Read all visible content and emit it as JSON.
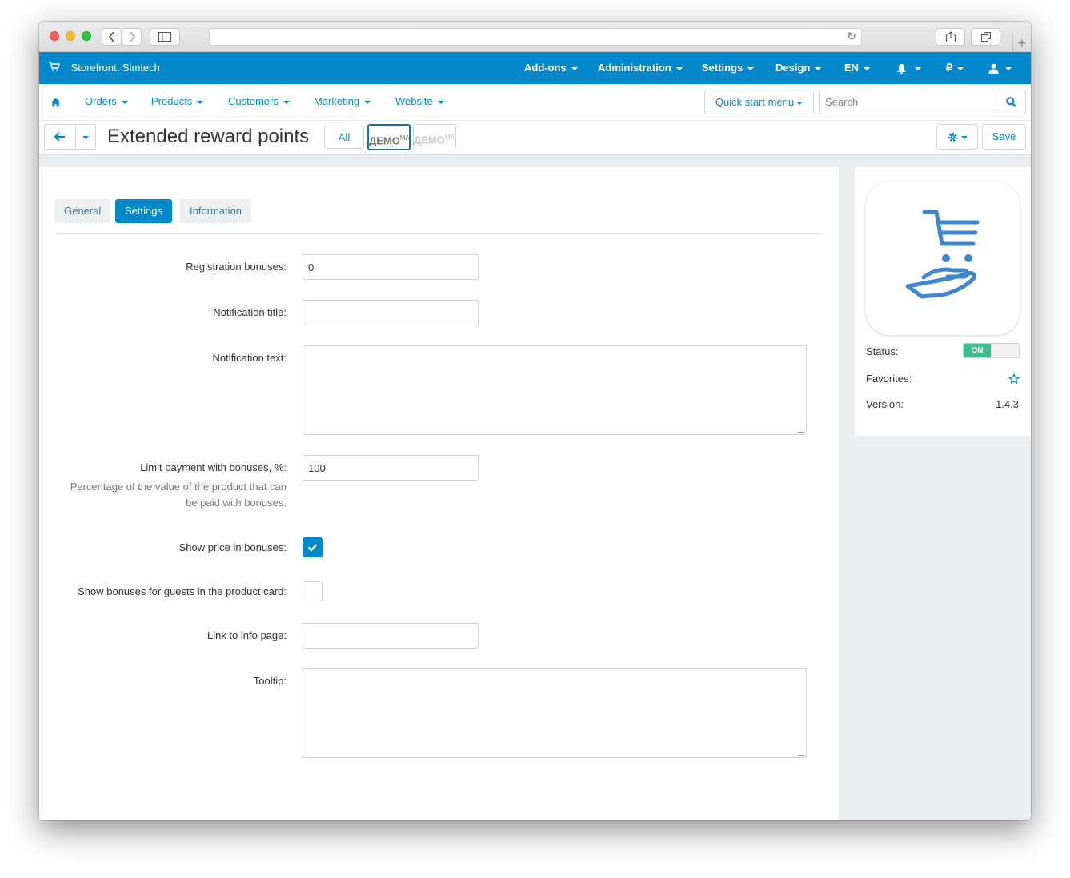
{
  "topbar": {
    "store_label": "Storefront: Simtech",
    "menu": [
      {
        "label": "Add-ons"
      },
      {
        "label": "Administration"
      },
      {
        "label": "Settings"
      },
      {
        "label": "Design"
      },
      {
        "label": "EN"
      },
      {
        "label": ""
      },
      {
        "label": "₽"
      },
      {
        "label": ""
      }
    ]
  },
  "subnav": {
    "items": [
      {
        "label": "Orders"
      },
      {
        "label": "Products"
      },
      {
        "label": "Customers"
      },
      {
        "label": "Marketing"
      },
      {
        "label": "Website"
      }
    ],
    "quick_start_label": "Quick start menu",
    "search_placeholder": "Search"
  },
  "page": {
    "title": "Extended reward points",
    "all_label": "All",
    "demo_label": "ДЕМО",
    "demo_sup": "MA",
    "save_label": "Save"
  },
  "tabs": [
    {
      "label": "General",
      "active": false
    },
    {
      "label": "Settings",
      "active": true
    },
    {
      "label": "Information",
      "active": false
    }
  ],
  "form": {
    "registration_bonuses": {
      "label": "Registration bonuses:",
      "value": "0"
    },
    "notification_title": {
      "label": "Notification title:",
      "value": ""
    },
    "notification_text": {
      "label": "Notification text:",
      "value": ""
    },
    "limit_payment": {
      "label": "Limit payment with bonuses, %:",
      "help_line1": "Percentage of the value of the product that can",
      "help_line2": "be paid with bonuses.",
      "value": "100"
    },
    "show_price": {
      "label": "Show price in bonuses:",
      "checked": true
    },
    "show_guests": {
      "label": "Show bonuses for guests in the product card:",
      "checked": false
    },
    "link_info": {
      "label": "Link to info page:",
      "value": ""
    },
    "tooltip": {
      "label": "Tooltip:",
      "value": ""
    }
  },
  "sidebar": {
    "status_label": "Status:",
    "status_value": "ON",
    "favorites_label": "Favorites:",
    "version_label": "Version:",
    "version_value": "1.4.3"
  },
  "colors": {
    "brand_blue": "#0388cc",
    "toggle_on": "#3cbf8d",
    "icon_blue": "#3f86d0"
  }
}
